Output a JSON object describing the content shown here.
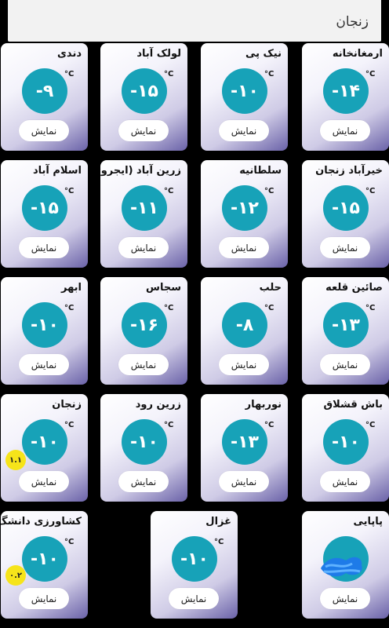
{
  "header": {
    "title": "زنجان"
  },
  "unit_label": "°C",
  "show_label": "نمایش",
  "cards": [
    {
      "name": "ارمغانخانه",
      "temp": "-۱۴"
    },
    {
      "name": "نیک پی",
      "temp": "-۱۰"
    },
    {
      "name": "لولک آباد",
      "temp": "-۱۵"
    },
    {
      "name": "دندی",
      "temp": "-۹"
    },
    {
      "name": "خیرآباد زنجان",
      "temp": "-۱۵"
    },
    {
      "name": "سلطانیه",
      "temp": "-۱۲"
    },
    {
      "name": "زرین آباد (ایجرود)",
      "temp": "-۱۱"
    },
    {
      "name": "اسلام آباد",
      "temp": "-۱۵"
    },
    {
      "name": "صائین قلعه",
      "temp": "-۱۳"
    },
    {
      "name": "حلب",
      "temp": "-۸"
    },
    {
      "name": "سجاس",
      "temp": "-۱۶"
    },
    {
      "name": "ابهر",
      "temp": "-۱۰"
    },
    {
      "name": "باش قشلاق",
      "temp": "-۱۰"
    },
    {
      "name": "نوربهار",
      "temp": "-۱۳"
    },
    {
      "name": "زرین رود",
      "temp": "-۱۰"
    },
    {
      "name": "زنجان",
      "temp": "-۱۰",
      "badge": "۱.۱"
    },
    {
      "name": "پاپایی",
      "temp": ""
    },
    {
      "name": "غزال",
      "temp": "-۱۰"
    },
    {
      "name": "کشاورزی دانشگ..",
      "temp": "-۱۰",
      "badge": "۰.۲"
    }
  ],
  "colors": {
    "accent": "#17a2b8",
    "badge": "#f6e41a",
    "background": "#000000"
  }
}
